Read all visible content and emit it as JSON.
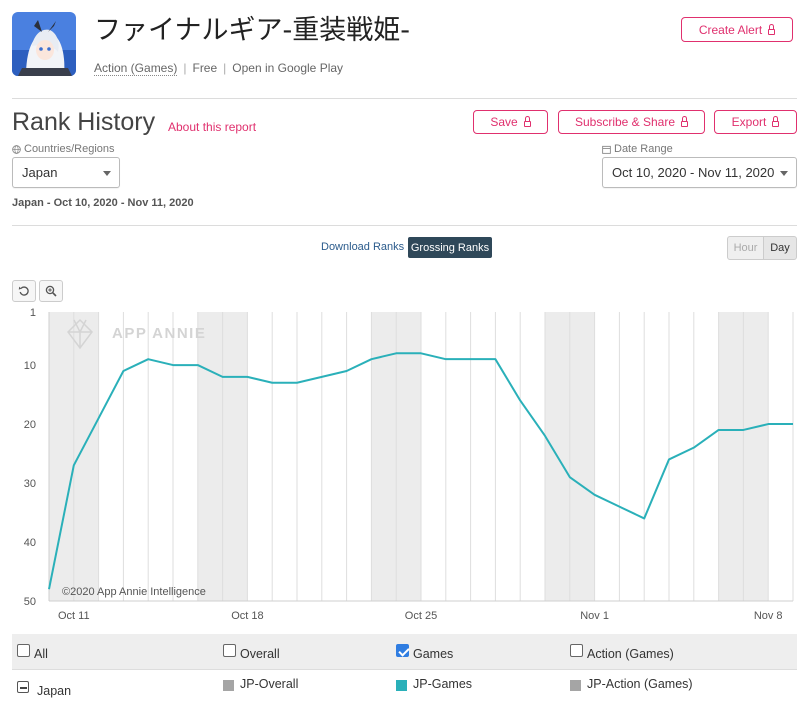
{
  "app": {
    "title": "ファイナルギア-重装戦姫-",
    "category": "Action (Games)",
    "price": "Free",
    "store_link": "Open in Google Play",
    "create_alert_label": "Create Alert"
  },
  "report": {
    "title": "Rank History",
    "about_link": "About this report",
    "save_label": "Save",
    "subscribe_label": "Subscribe & Share",
    "export_label": "Export",
    "countries_label": "Countries/Regions",
    "country_value": "Japan",
    "date_range_label": "Date Range",
    "date_range_value": "Oct 10, 2020 - Nov 11, 2020",
    "summary": "Japan - Oct 10, 2020 - Nov 11, 2020"
  },
  "tabs": {
    "download_ranks": "Download Ranks",
    "grossing_ranks": "Grossing Ranks",
    "hour": "Hour",
    "day": "Day"
  },
  "chart_data": {
    "type": "line",
    "watermark": "APP ANNIE",
    "credit": "©2020 App Annie Intelligence",
    "y_reversed": true,
    "ylim": [
      1,
      50
    ],
    "y_ticks": [
      "1",
      "10",
      "20",
      "30",
      "40",
      "50"
    ],
    "y_tick_values": [
      1,
      10,
      20,
      30,
      40,
      50
    ],
    "x_tick_labels": [
      "Oct 11",
      "Oct 18",
      "Oct 25",
      "Nov 1",
      "Nov 8"
    ],
    "x_tick_days": [
      1,
      8,
      15,
      22,
      29
    ],
    "weekend_day_pairs": [
      [
        0,
        1
      ],
      [
        6,
        7
      ],
      [
        13,
        14
      ],
      [
        20,
        21
      ],
      [
        27,
        28
      ]
    ],
    "day_count": 30,
    "color": "#2ab0b9",
    "series": [
      {
        "name": "JP-Games",
        "x_days": [
          0,
          1,
          2,
          3,
          4,
          5,
          6,
          7,
          8,
          9,
          10,
          11,
          12,
          13,
          14,
          15,
          16,
          17,
          18,
          19,
          20,
          21,
          22,
          23,
          24,
          25,
          26,
          27,
          28,
          29,
          30
        ],
        "values": [
          48,
          27,
          19,
          11,
          9,
          10,
          10,
          12,
          12,
          13,
          13,
          12,
          11,
          9,
          8,
          8,
          9,
          9,
          9,
          16,
          22,
          29,
          32,
          34,
          36,
          26,
          24,
          21,
          21,
          20,
          20
        ]
      }
    ]
  },
  "legend": {
    "all": "All",
    "overall": "Overall",
    "games": "Games",
    "action_games": "Action (Games)",
    "row_country": "Japan",
    "jp_overall": "JP-Overall",
    "jp_games": "JP-Games",
    "jp_action": "JP-Action (Games)",
    "colors": {
      "overall": "#a5a5a5",
      "games": "#2ab0b9",
      "action": "#a5a5a5"
    }
  }
}
